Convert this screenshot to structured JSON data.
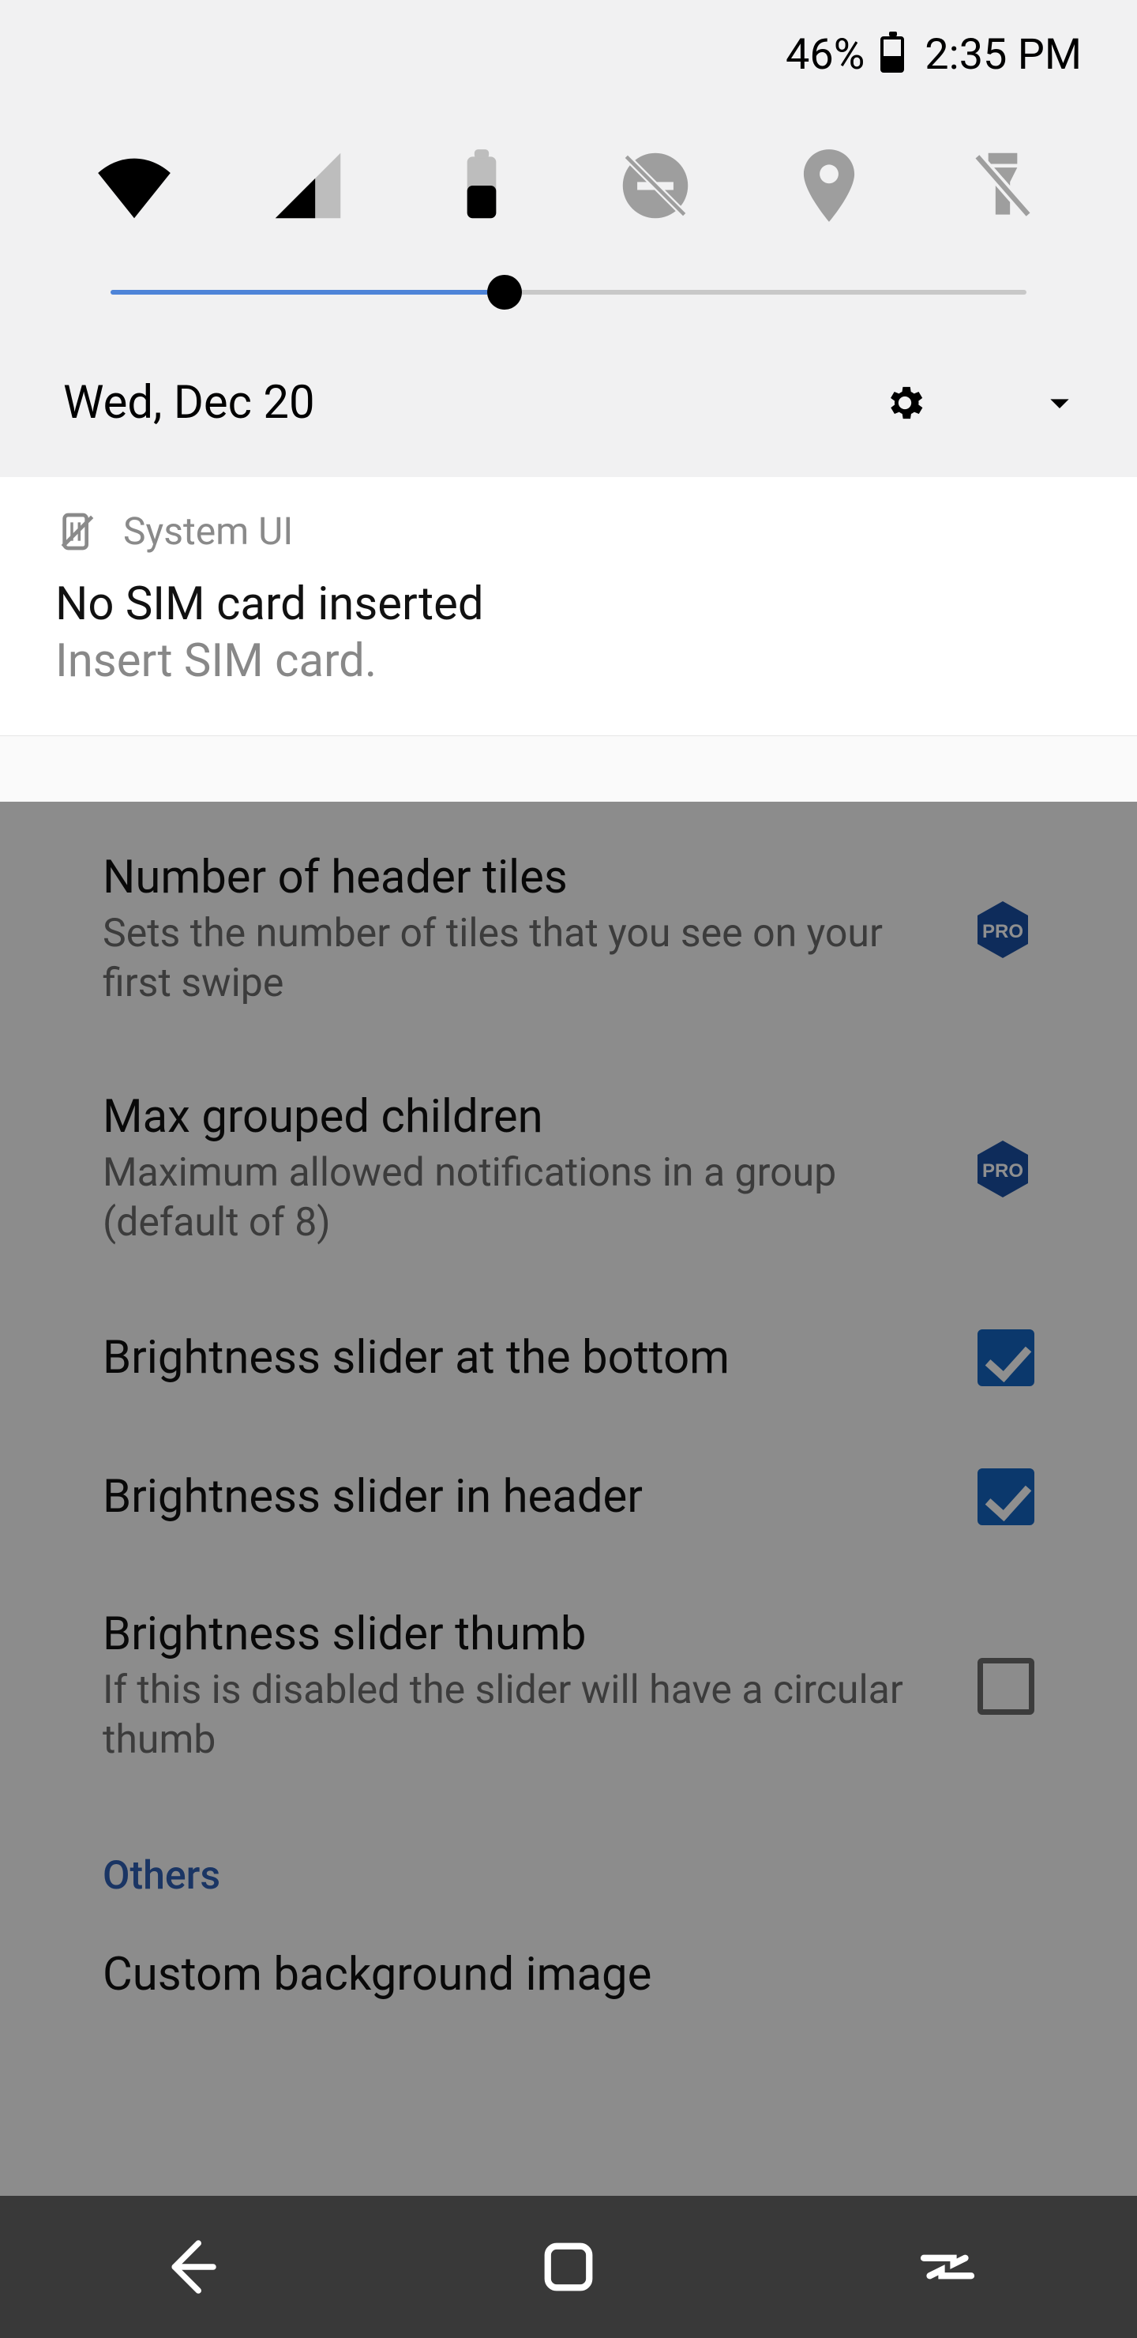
{
  "status_bar": {
    "battery_pct": "46%",
    "time": "2:35 PM"
  },
  "quick_settings": {
    "tiles": [
      {
        "name": "wifi",
        "active": true
      },
      {
        "name": "cell",
        "active": true
      },
      {
        "name": "battery",
        "active": true
      },
      {
        "name": "dnd",
        "active": false
      },
      {
        "name": "location",
        "active": false
      },
      {
        "name": "flashlight",
        "active": false
      }
    ],
    "brightness_pct": 43,
    "date": "Wed, Dec 20"
  },
  "notification": {
    "app": "System UI",
    "title": "No SIM card inserted",
    "subtitle": "Insert SIM card."
  },
  "settings": {
    "rows": [
      {
        "title": "Number of header tiles",
        "sub": "Sets the number of tiles that you see on your first swipe",
        "trailing": "pro"
      },
      {
        "title": "Max grouped children",
        "sub": "Maximum allowed notifications in a group (default of 8)",
        "trailing": "pro"
      },
      {
        "title": "Brightness slider at the bottom",
        "sub": "",
        "trailing": "checked"
      },
      {
        "title": "Brightness slider in header",
        "sub": "",
        "trailing": "checked"
      },
      {
        "title": "Brightness slider thumb",
        "sub": "If this is disabled the slider will have a circular thumb",
        "trailing": "unchecked"
      }
    ],
    "section_header": "Others",
    "extra_row": {
      "title": "Custom background image"
    }
  }
}
